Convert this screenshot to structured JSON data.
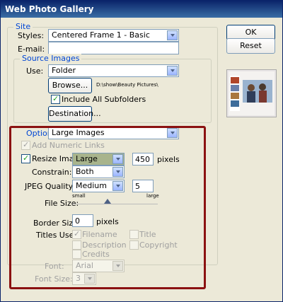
{
  "window": {
    "title": "Web Photo Gallery"
  },
  "buttons": {
    "ok": "OK",
    "reset": "Reset"
  },
  "site": {
    "legend": "Site",
    "styles_label": "Styles:",
    "styles_value": "Centered Frame 1 - Basic",
    "email_label": "E-mail:",
    "email_value": ""
  },
  "source": {
    "legend": "Source Images",
    "use_label": "Use:",
    "use_value": "Folder",
    "browse_label": "Browse...",
    "path": "D:\\show\\Beauty Pictures\\",
    "include_subfolders_label": "Include All Subfolders",
    "include_subfolders_checked": true,
    "destination_label": "Destination..."
  },
  "options": {
    "label": "Options:",
    "value": "Large Images",
    "add_numeric_links_label": "Add Numeric Links",
    "add_numeric_links_checked": true,
    "resize_images_label": "Resize Images:",
    "resize_images_checked": true,
    "resize_value": "Large",
    "resize_pixels": "450",
    "pixels_unit": "pixels",
    "constrain_label": "Constrain:",
    "constrain_value": "Both",
    "jpeg_quality_label": "JPEG Quality:",
    "jpeg_quality_value": "Medium",
    "jpeg_quality_number": "5",
    "file_size_label": "File Size:",
    "file_size_small": "small",
    "file_size_large": "large",
    "file_size_level": 0.41,
    "border_size_label": "Border Size:",
    "border_size_value": "0",
    "border_unit": "pixels",
    "titles_use_label": "Titles Use:",
    "titles_use": {
      "filename": "Filename",
      "title": "Title",
      "description": "Description",
      "copyright": "Copyright",
      "credits": "Credits"
    },
    "font_label": "Font:",
    "font_value": "Arial",
    "font_size_label": "Font Size:",
    "font_size_value": "3"
  },
  "colors": {
    "highlight": "#8b1111",
    "title_bar": "#0a246a",
    "group_title": "#0046d5"
  }
}
